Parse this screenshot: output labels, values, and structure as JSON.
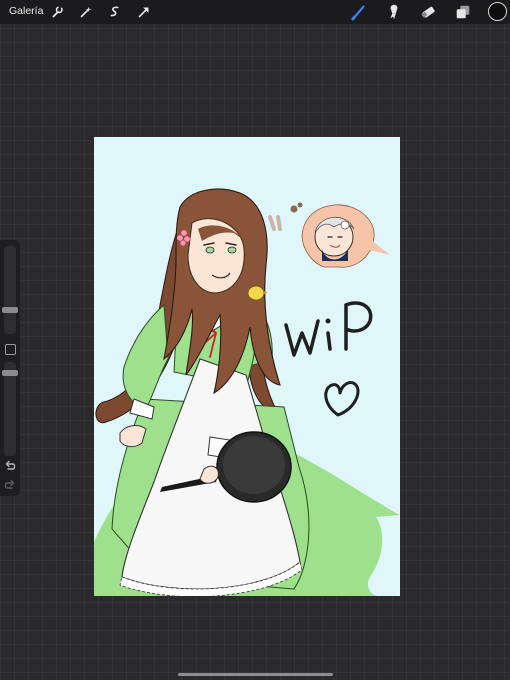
{
  "topbar": {
    "gallery_label": "Galería",
    "left_tools": [
      "wrench-icon",
      "magic-wand-icon",
      "selection-icon",
      "transform-arrow-icon"
    ],
    "right_tools": [
      "brush-icon",
      "smudge-icon",
      "eraser-icon",
      "layers-icon"
    ],
    "active_tool": "brush-icon",
    "accent_color": "#3b82f6",
    "current_color": "#0d0d0d"
  },
  "sidebar": {
    "brush_size_level": 0.35,
    "opacity_level": 0.5,
    "buttons": [
      "modify-square-icon",
      "undo-icon",
      "redo-icon"
    ]
  },
  "canvas": {
    "background_color": "#dff7fb",
    "handwritten_text": "wip"
  }
}
